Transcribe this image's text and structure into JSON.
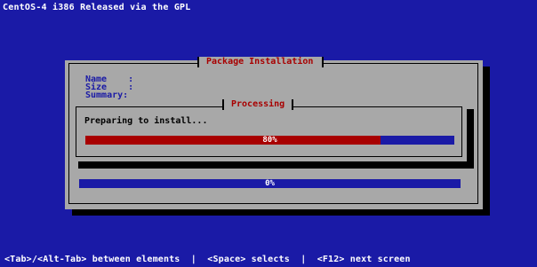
{
  "screen": {
    "top_title": "CentOS-4 i386 Released via the GPL",
    "bottom_help": "<Tab>/<Alt-Tab> between elements  |  <Space> selects  |  <F12> next screen"
  },
  "dialog": {
    "title": "Package Installation",
    "fields": [
      {
        "label": "Name    :"
      },
      {
        "label": "Size    :"
      },
      {
        "label": "Summary:"
      }
    ]
  },
  "processing": {
    "title": "Processing",
    "message": "Preparing to install...",
    "progress": {
      "percent": 80,
      "label": "80%"
    }
  },
  "overall_progress": {
    "percent": 0,
    "label": "0%"
  },
  "colors": {
    "background": "#1a1aa6",
    "dialog": "#a8a8a8",
    "accent": "#a80000"
  }
}
